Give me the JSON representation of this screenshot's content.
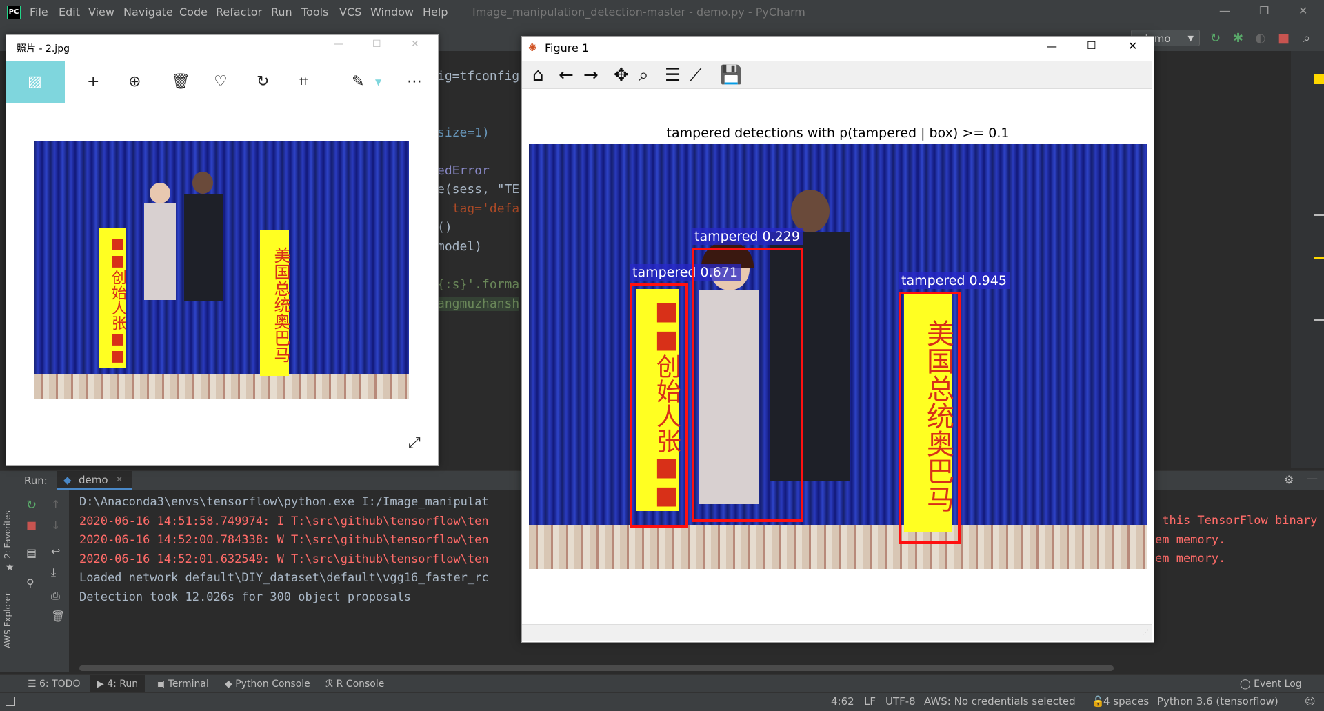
{
  "ide": {
    "menu": [
      "File",
      "Edit",
      "View",
      "Navigate",
      "Code",
      "Refactor",
      "Run",
      "Tools",
      "VCS",
      "Window",
      "Help"
    ],
    "title": "Image_manipulation_detection-master - demo.py - PyCharm",
    "run_config": "demo",
    "code_lines": [
      "ig=tfconfig",
      "size=1)",
      "edError",
      "e(sess, \"TE",
      "  tag='defa",
      "()",
      "model)",
      "{:s}'.forma",
      "angmuzhansh"
    ],
    "run_label": "Run:",
    "run_tab": "demo",
    "console": [
      {
        "text": "D:\\Anaconda3\\envs\\tensorflow\\python.exe I:/Image_manipulat",
        "color": "#a9b7c6"
      },
      {
        "text": "2020-06-16 14:51:58.749974: I T:\\src\\github\\tensorflow\\ten",
        "color": "#ff6b68"
      },
      {
        "text": "2020-06-16 14:52:00.784338: W T:\\src\\github\\tensorflow\\ten",
        "color": "#ff6b68"
      },
      {
        "text": "2020-06-16 14:52:01.632549: W T:\\src\\github\\tensorflow\\ten",
        "color": "#ff6b68"
      },
      {
        "text": "Loaded network default\\DIY_dataset\\default\\vgg16_faster_rc",
        "color": "#a9b7c6"
      },
      {
        "text": "Detection took 12.026s for 300 object proposals",
        "color": "#a9b7c6"
      }
    ],
    "console_right": [
      " this TensorFlow binary",
      "em memory.",
      "em memory."
    ],
    "left_strip": [
      "2: Favorites",
      "AWS Explorer"
    ],
    "bottom_tabs": [
      "6: TODO",
      "4: Run",
      "Terminal",
      "Python Console",
      "R Console",
      "Event Log"
    ],
    "status": {
      "position": "4:62",
      "line_sep": "LF",
      "encoding": "UTF-8",
      "aws": "AWS: No credentials selected",
      "indent": "4 spaces",
      "interpreter": "Python 3.6 (tensorflow)"
    }
  },
  "photos": {
    "title": "照片 - 2.jpg",
    "banner_left": "■■创始人张■■",
    "banner_right": "美国总统奥巴马"
  },
  "figure": {
    "window_title": "Figure 1",
    "plot_title": "tampered detections with p(tampered | box) >= 0.1",
    "detections": [
      {
        "label": "tampered 0.671",
        "score": 0.671
      },
      {
        "label": "tampered 0.229",
        "score": 0.229
      },
      {
        "label": "tampered 0.945",
        "score": 0.945
      }
    ],
    "banner_left": "■■创始人张■■",
    "banner_right": "美国总统奥巴马"
  },
  "colors": {
    "box": "#ff1010",
    "label_bg": "#2828c8",
    "banner": "#ffff22",
    "banner_text": "#d83018",
    "curtain": "#1a2490"
  }
}
